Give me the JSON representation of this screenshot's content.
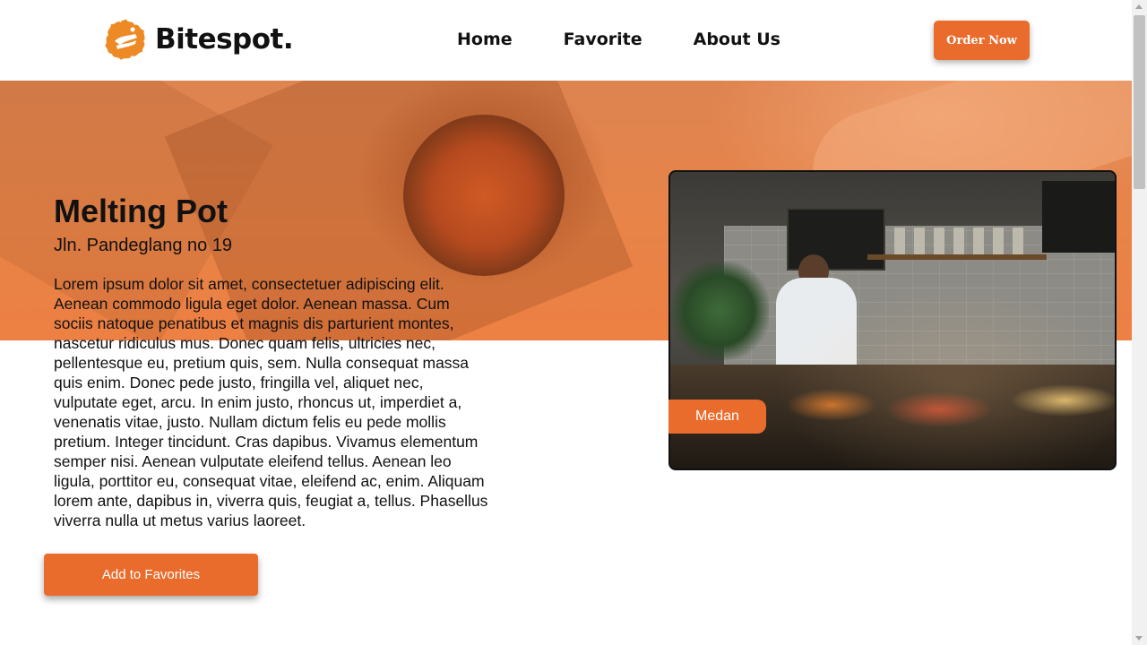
{
  "navbar": {
    "brand": "Bitespot.",
    "logo_icon": "splash-logo-icon",
    "links": [
      {
        "label": "Home"
      },
      {
        "label": "Favorite"
      },
      {
        "label": "About Us"
      }
    ],
    "cta_label": "Order Now"
  },
  "restaurant": {
    "name": "Melting Pot",
    "address": "Jln. Pandeglang no 19",
    "description": "Lorem ipsum dolor sit amet, consectetuer adipiscing elit. Aenean commodo ligula eget dolor. Aenean massa. Cum sociis natoque penatibus et magnis dis parturient montes, nascetur ridiculus mus. Donec quam felis, ultricies nec, pellentesque eu, pretium quis, sem. Nulla consequat massa quis enim. Donec pede justo, fringilla vel, aliquet nec, vulputate eget, arcu. In enim justo, rhoncus ut, imperdiet a, venenatis vitae, justo. Nullam dictum felis eu pede mollis pretium. Integer tincidunt. Cras dapibus. Vivamus elementum semper nisi. Aenean vulputate eleifend tellus. Aenean leo ligula, porttitor eu, consequat vitae, eleifend ac, enim. Aliquam lorem ante, dapibus in, viverra quis, feugiat a, tellus. Phasellus viverra nulla ut metus varius laoreet.",
    "city": "Medan",
    "favorite_button": "Add to Favorites"
  },
  "colors": {
    "accent": "#e96c2c",
    "text": "#111111"
  }
}
